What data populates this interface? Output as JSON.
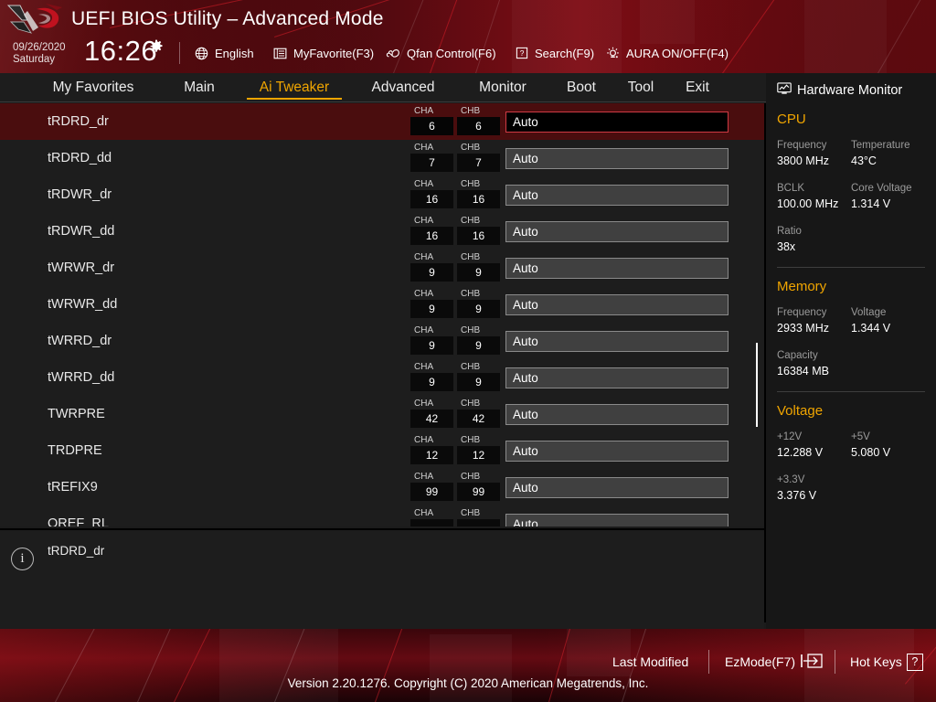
{
  "header": {
    "title": "UEFI BIOS Utility – Advanced Mode",
    "date": "09/26/2020",
    "weekday": "Saturday",
    "time": "16:26",
    "gear_icon": "gear-icon",
    "items": [
      {
        "label": "English",
        "icon": "globe-icon"
      },
      {
        "label": "MyFavorite(F3)",
        "icon": "list-icon"
      },
      {
        "label": "Qfan Control(F6)",
        "icon": "fan-icon"
      },
      {
        "label": "Search(F9)",
        "icon": "question-box-icon"
      },
      {
        "label": "AURA ON/OFF(F4)",
        "icon": "aura-light-icon"
      }
    ]
  },
  "nav": {
    "tabs": [
      {
        "label": "My Favorites",
        "active": false
      },
      {
        "label": "Main",
        "active": false
      },
      {
        "label": "Ai Tweaker",
        "active": true
      },
      {
        "label": "Advanced",
        "active": false
      },
      {
        "label": "Monitor",
        "active": false
      },
      {
        "label": "Boot",
        "active": false
      },
      {
        "label": "Tool",
        "active": false
      },
      {
        "label": "Exit",
        "active": false
      }
    ],
    "accent_color": "#f0a500"
  },
  "settings": {
    "cha_caption": "CHA",
    "chb_caption": "CHB",
    "rows": [
      {
        "label": "tRDRD_dr",
        "cha": "6",
        "chb": "6",
        "value": "Auto",
        "selected": true
      },
      {
        "label": "tRDRD_dd",
        "cha": "7",
        "chb": "7",
        "value": "Auto",
        "selected": false
      },
      {
        "label": "tRDWR_dr",
        "cha": "16",
        "chb": "16",
        "value": "Auto",
        "selected": false
      },
      {
        "label": "tRDWR_dd",
        "cha": "16",
        "chb": "16",
        "value": "Auto",
        "selected": false
      },
      {
        "label": "tWRWR_dr",
        "cha": "9",
        "chb": "9",
        "value": "Auto",
        "selected": false
      },
      {
        "label": "tWRWR_dd",
        "cha": "9",
        "chb": "9",
        "value": "Auto",
        "selected": false
      },
      {
        "label": "tWRRD_dr",
        "cha": "9",
        "chb": "9",
        "value": "Auto",
        "selected": false
      },
      {
        "label": "tWRRD_dd",
        "cha": "9",
        "chb": "9",
        "value": "Auto",
        "selected": false
      },
      {
        "label": "TWRPRE",
        "cha": "42",
        "chb": "42",
        "value": "Auto",
        "selected": false
      },
      {
        "label": "TRDPRE",
        "cha": "12",
        "chb": "12",
        "value": "Auto",
        "selected": false
      },
      {
        "label": "tREFIX9",
        "cha": "99",
        "chb": "99",
        "value": "Auto",
        "selected": false
      },
      {
        "label": "QREF_RL",
        "cha": "",
        "chb": "",
        "value": "Auto",
        "selected": false
      }
    ]
  },
  "info": {
    "icon": "info-circle-icon",
    "glyph": "i",
    "text": "tRDRD_dr"
  },
  "hardware_monitor": {
    "title": "Hardware Monitor",
    "icon": "monitor-icon",
    "sections": [
      {
        "name": "CPU",
        "rows": [
          [
            {
              "key": "Frequency",
              "val": "3800 MHz"
            },
            {
              "key": "Temperature",
              "val": "43°C"
            }
          ],
          [
            {
              "key": "BCLK",
              "val": "100.00 MHz"
            },
            {
              "key": "Core Voltage",
              "val": "1.314 V"
            }
          ],
          [
            {
              "key": "Ratio",
              "val": "38x"
            }
          ]
        ]
      },
      {
        "name": "Memory",
        "rows": [
          [
            {
              "key": "Frequency",
              "val": "2933 MHz"
            },
            {
              "key": "Voltage",
              "val": "1.344 V"
            }
          ],
          [
            {
              "key": "Capacity",
              "val": "16384 MB"
            }
          ]
        ]
      },
      {
        "name": "Voltage",
        "rows": [
          [
            {
              "key": "+12V",
              "val": "12.288 V"
            },
            {
              "key": "+5V",
              "val": "5.080 V"
            }
          ],
          [
            {
              "key": "+3.3V",
              "val": "3.376 V"
            }
          ]
        ]
      }
    ]
  },
  "footer": {
    "last_modified": "Last Modified",
    "ezmode": "EzMode(F7)",
    "hotkeys": "Hot Keys",
    "hotkeys_key": "?",
    "copyright": "Version 2.20.1276. Copyright (C) 2020 American Megatrends, Inc."
  }
}
